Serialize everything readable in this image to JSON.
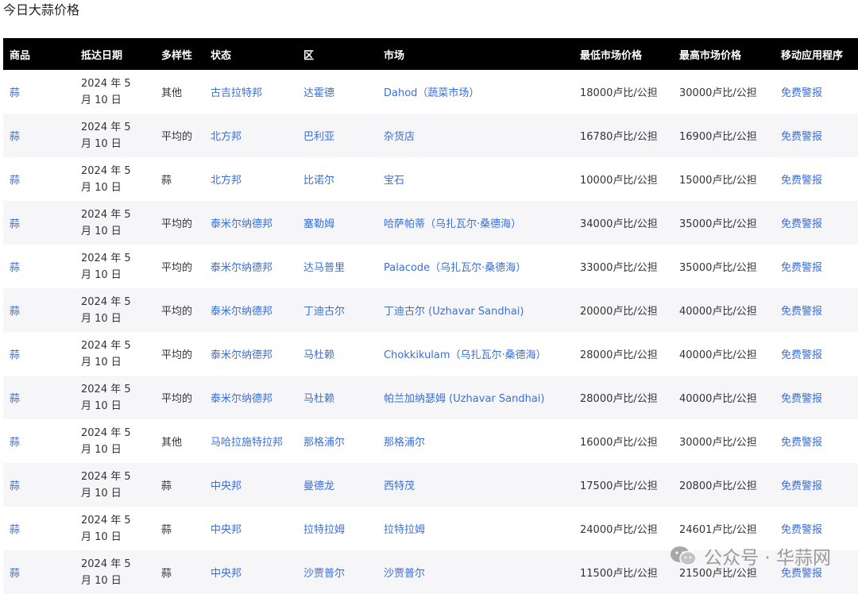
{
  "title": "今日大蒜价格",
  "table": {
    "headers": [
      "商品",
      "抵达日期",
      "多样性",
      "状态",
      "区",
      "市场",
      "最低市场价格",
      "最高市场价格",
      "移动应用程序"
    ],
    "rows": [
      {
        "commodity": "蒜",
        "date": "2024 年 5 月 10 日",
        "variety": "其他",
        "state": "古吉拉特邦",
        "district": "达霍德",
        "market": "Dahod（蔬菜市场）",
        "min": "18000卢比/公担",
        "max": "30000卢比/公担",
        "app": "免费警报"
      },
      {
        "commodity": "蒜",
        "date": "2024 年 5 月 10 日",
        "variety": "平均的",
        "state": "北方邦",
        "district": "巴利亚",
        "market": "杂货店",
        "min": "16780卢比/公担",
        "max": "16900卢比/公担",
        "app": "免费警报"
      },
      {
        "commodity": "蒜",
        "date": "2024 年 5 月 10 日",
        "variety": "蒜",
        "state": "北方邦",
        "district": "比诺尔",
        "market": "宝石",
        "min": "10000卢比/公担",
        "max": "15000卢比/公担",
        "app": "免费警报"
      },
      {
        "commodity": "蒜",
        "date": "2024 年 5 月 10 日",
        "variety": "平均的",
        "state": "泰米尔纳德邦",
        "district": "塞勒姆",
        "market": "哈萨帕蒂（乌扎瓦尔·桑德海）",
        "min": "34000卢比/公担",
        "max": "35000卢比/公担",
        "app": "免费警报"
      },
      {
        "commodity": "蒜",
        "date": "2024 年 5 月 10 日",
        "variety": "平均的",
        "state": "泰米尔纳德邦",
        "district": "达马普里",
        "market": "Palacode（乌扎瓦尔·桑德海）",
        "min": "33000卢比/公担",
        "max": "35000卢比/公担",
        "app": "免费警报"
      },
      {
        "commodity": "蒜",
        "date": "2024 年 5 月 10 日",
        "variety": "平均的",
        "state": "泰米尔纳德邦",
        "district": "丁迪古尔",
        "market": "丁迪古尔 (Uzhavar Sandhai)",
        "min": "20000卢比/公担",
        "max": "40000卢比/公担",
        "app": "免费警报"
      },
      {
        "commodity": "蒜",
        "date": "2024 年 5 月 10 日",
        "variety": "平均的",
        "state": "泰米尔纳德邦",
        "district": "马杜赖",
        "market": "Chokkikulam（乌扎瓦尔·桑德海）",
        "min": "28000卢比/公担",
        "max": "40000卢比/公担",
        "app": "免费警报"
      },
      {
        "commodity": "蒜",
        "date": "2024 年 5 月 10 日",
        "variety": "平均的",
        "state": "泰米尔纳德邦",
        "district": "马杜赖",
        "market": "帕兰加纳瑟姆 (Uzhavar Sandhai)",
        "min": "28000卢比/公担",
        "max": "40000卢比/公担",
        "app": "免费警报"
      },
      {
        "commodity": "蒜",
        "date": "2024 年 5 月 10 日",
        "variety": "其他",
        "state": "马哈拉施特拉邦",
        "district": "那格浦尔",
        "market": "那格浦尔",
        "min": "16000卢比/公担",
        "max": "30000卢比/公担",
        "app": "免费警报"
      },
      {
        "commodity": "蒜",
        "date": "2024 年 5 月 10 日",
        "variety": "蒜",
        "state": "中央邦",
        "district": "曼德龙",
        "market": "西特茂",
        "min": "17500卢比/公担",
        "max": "20800卢比/公担",
        "app": "免费警报"
      },
      {
        "commodity": "蒜",
        "date": "2024 年 5 月 10 日",
        "variety": "蒜",
        "state": "中央邦",
        "district": "拉特拉姆",
        "market": "拉特拉姆",
        "min": "24000卢比/公担",
        "max": "24601卢比/公担",
        "app": "免费警报"
      },
      {
        "commodity": "蒜",
        "date": "2024 年 5 月 10 日",
        "variety": "蒜",
        "state": "中央邦",
        "district": "沙贾普尔",
        "market": "沙贾普尔",
        "min": "11500卢比/公担",
        "max": "21500卢比/公担",
        "app": "免费警报"
      }
    ]
  },
  "watermark": {
    "text": "公众号 · 华蒜网",
    "icon": "wechat-icon"
  }
}
